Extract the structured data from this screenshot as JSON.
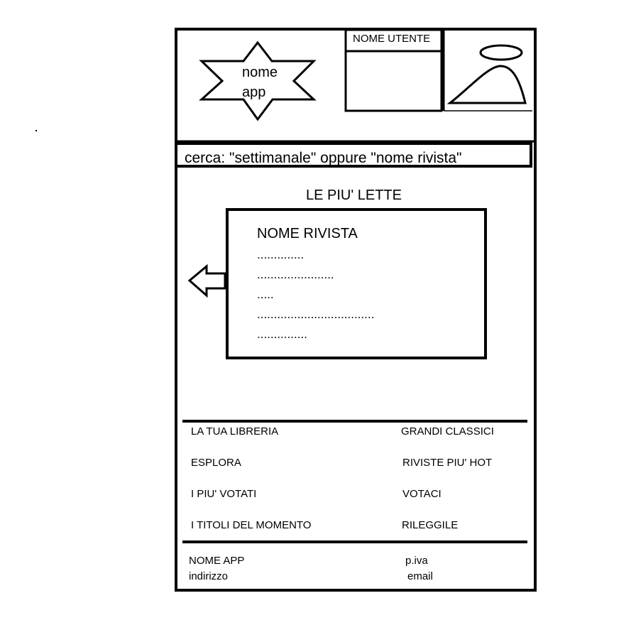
{
  "header": {
    "logo_line1": "nome",
    "logo_line2": "app",
    "user_label": "NOME UTENTE"
  },
  "search": {
    "text": "cerca: \"settimanale\" oppure \"nome rivista\""
  },
  "featured": {
    "section_title": "LE PIU' LETTE",
    "magazine_title": "NOME RIVISTA",
    "detail_lines": [
      "..............",
      ".......................",
      ".....",
      "...................................",
      "..............."
    ]
  },
  "nav": {
    "left": [
      "LA TUA LIBRERIA",
      "ESPLORA",
      "I PIU' VOTATI",
      "I TITOLI DEL MOMENTO"
    ],
    "right": [
      "GRANDI CLASSICI",
      "RIVISTE PIU' HOT",
      "VOTACI",
      "RILEGGILE"
    ]
  },
  "footer": {
    "app_name": "NOME APP",
    "address": "indirizzo",
    "vat": "p.iva",
    "email": "email"
  },
  "icons": {
    "logo": "star-icon",
    "avatar": "user-avatar-icon",
    "prev": "arrow-left-icon"
  }
}
